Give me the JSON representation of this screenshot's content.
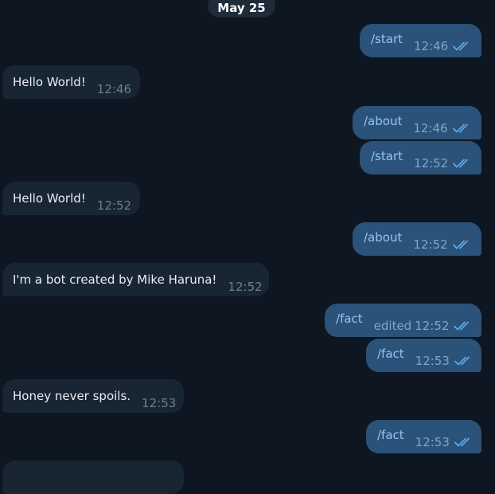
{
  "chat": {
    "date_separator": "May 25",
    "messages": [
      {
        "direction": "out",
        "text": "/start",
        "time": "12:46",
        "edited": "",
        "read": true
      },
      {
        "direction": "in",
        "text": "Hello World!",
        "time": "12:46"
      },
      {
        "direction": "out",
        "text": "/about",
        "time": "12:46",
        "edited": "",
        "read": true
      },
      {
        "direction": "out",
        "text": "/start",
        "time": "12:52",
        "edited": "",
        "read": true
      },
      {
        "direction": "in",
        "text": "Hello World!",
        "time": "12:52"
      },
      {
        "direction": "out",
        "text": "/about",
        "time": "12:52",
        "edited": "",
        "read": true
      },
      {
        "direction": "in",
        "text": "I'm a bot created by Mike Haruna!",
        "time": "12:52"
      },
      {
        "direction": "out",
        "text": "/fact",
        "time": "12:52",
        "edited": "edited",
        "read": true
      },
      {
        "direction": "out",
        "text": "/fact",
        "time": "12:53",
        "edited": "",
        "read": true
      },
      {
        "direction": "in",
        "text": "Honey never spoils.",
        "time": "12:53"
      },
      {
        "direction": "out",
        "text": "/fact",
        "time": "12:53",
        "edited": "",
        "read": true
      }
    ]
  },
  "colors": {
    "background": "#0e1621",
    "incoming_bubble": "#182533",
    "outgoing_bubble": "#2b5278",
    "outgoing_text": "#8fc7f8",
    "read_check": "#5fa8e8"
  },
  "icons": {
    "read_receipt": "double-check-icon"
  }
}
